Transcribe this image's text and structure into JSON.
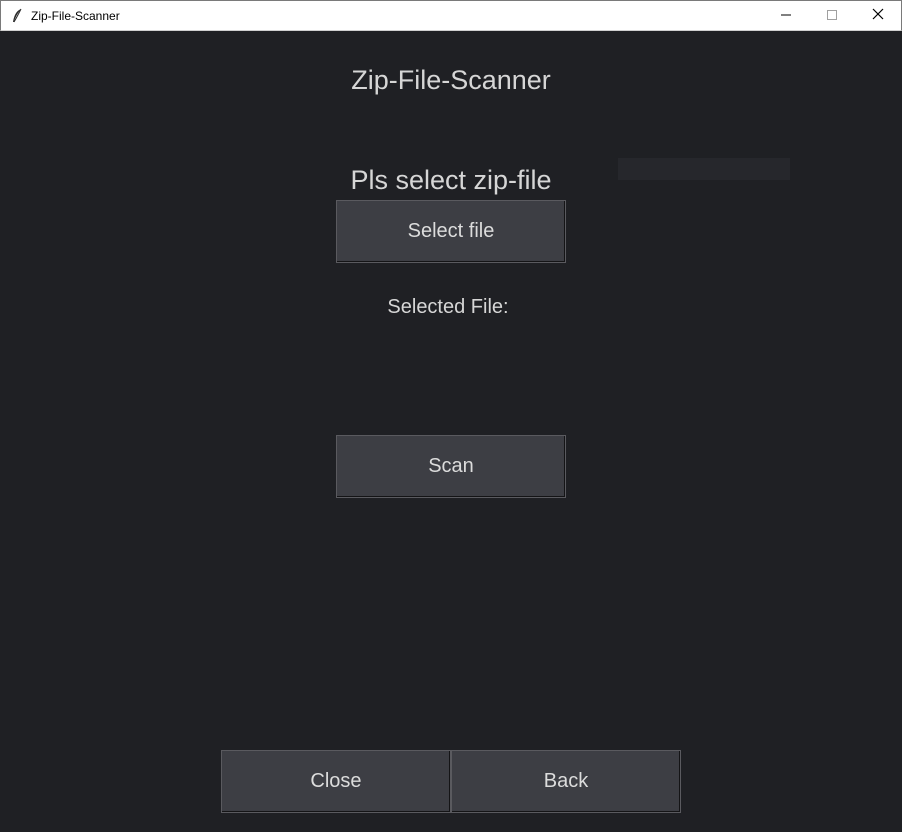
{
  "window": {
    "title": "Zip-File-Scanner",
    "controls": {
      "minimize": "minimize-icon",
      "maximize": "maximize-icon",
      "close": "close-icon"
    }
  },
  "main": {
    "title": "Zip-File-Scanner",
    "prompt": "Pls select zip-file",
    "select_button": "Select file",
    "selected_label": "Selected File:",
    "scan_button": "Scan"
  },
  "footer": {
    "close_button": "Close",
    "back_button": "Back"
  },
  "colors": {
    "background": "#1f2024",
    "button": "#3d3e44",
    "text": "#d6d6d6"
  }
}
